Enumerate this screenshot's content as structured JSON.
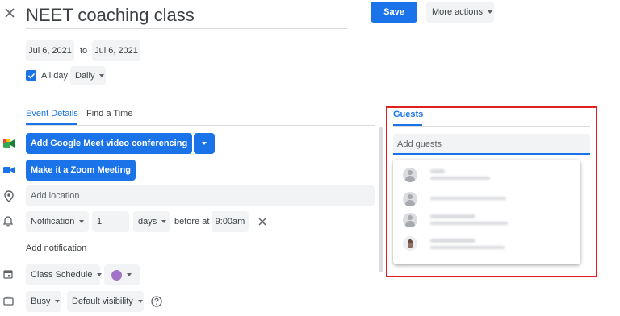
{
  "header": {
    "title": "NEET coaching class",
    "save_label": "Save",
    "more_actions_label": "More actions"
  },
  "dates": {
    "start": "Jul 6, 2021",
    "to_label": "to",
    "end": "Jul 6, 2021"
  },
  "allday": {
    "label": "All day",
    "checked": true,
    "repeat": "Daily"
  },
  "tabs": [
    {
      "label": "Event Details",
      "active": true
    },
    {
      "label": "Find a Time",
      "active": false
    }
  ],
  "details": {
    "meet_button": "Add Google Meet video conferencing",
    "zoom_button": "Make it a Zoom Meeting",
    "location_placeholder": "Add location",
    "notification": {
      "type": "Notification",
      "amount": "1",
      "unit": "days",
      "before_at_label": "before at",
      "time": "9:00am"
    },
    "add_notification": "Add notification",
    "calendar": "Class Schedule",
    "event_color": "#a173c8",
    "status": "Busy",
    "visibility": "Default visibility"
  },
  "guests": {
    "tab_label": "Guests",
    "input_placeholder": "Add guests",
    "highlight_color": "#e02020"
  },
  "colors": {
    "accent": "#1a73e8",
    "meet_icon": "#34a853",
    "zoom_icon": "#1a73e8"
  }
}
